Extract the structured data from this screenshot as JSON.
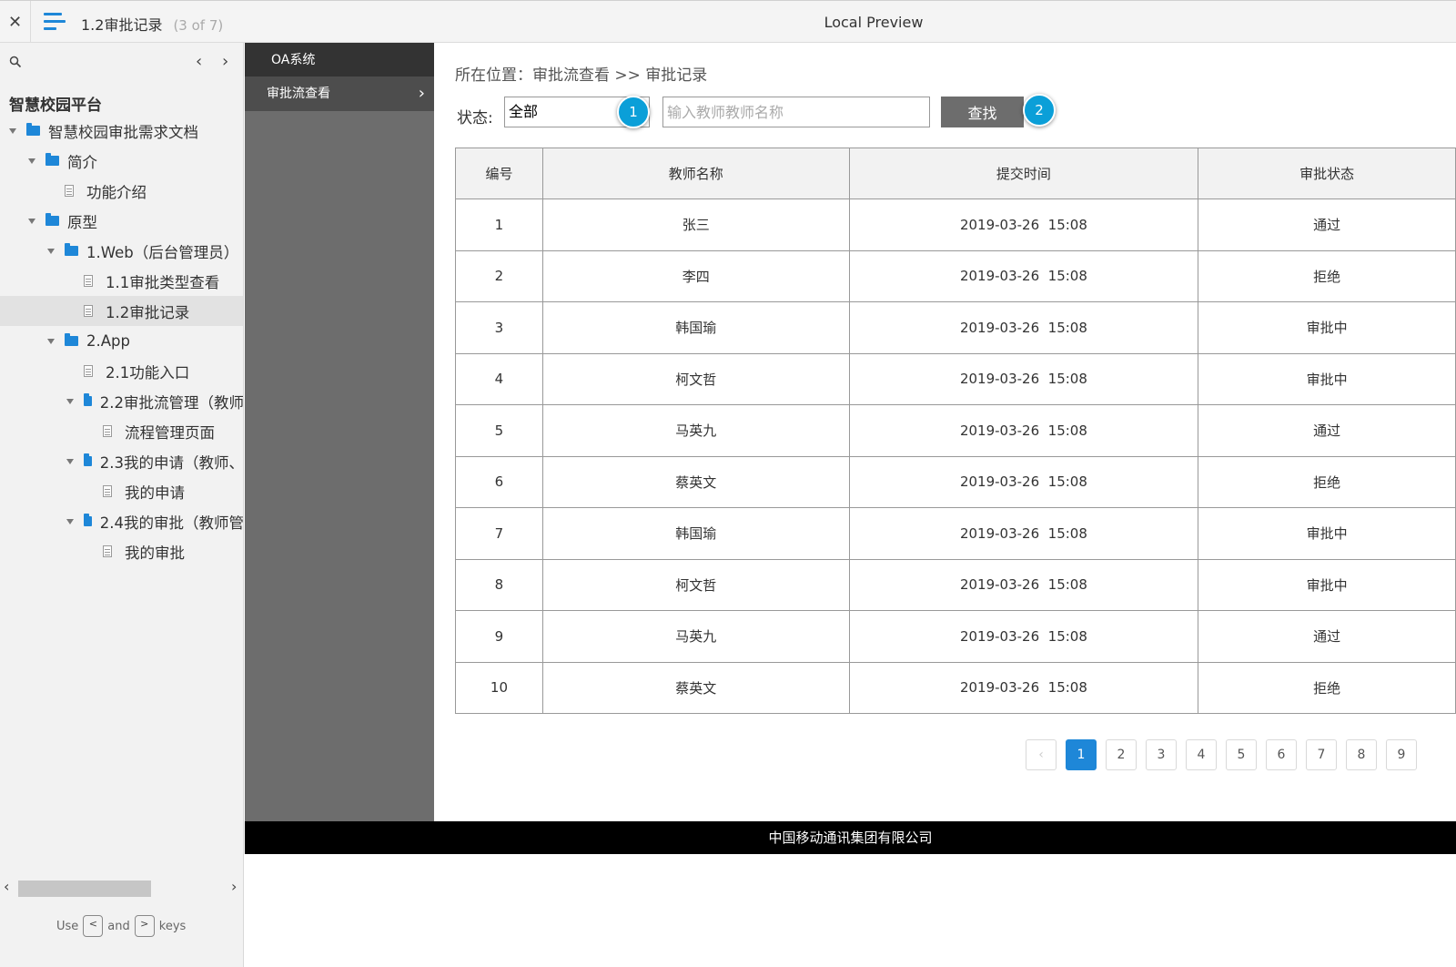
{
  "topbar": {
    "close_label": "✕",
    "page_title": "1.2审批记录",
    "page_count": "(3 of 7)",
    "window_title": "Local Preview"
  },
  "sidebar": {
    "root_title": "智慧校园平台",
    "tree": [
      {
        "label": "智慧校园审批需求文档",
        "kind": "folder",
        "level": 0
      },
      {
        "label": "简介",
        "kind": "folder",
        "level": 1
      },
      {
        "label": "功能介绍",
        "kind": "page",
        "level": 2
      },
      {
        "label": "原型",
        "kind": "folder",
        "level": 1
      },
      {
        "label": "1.Web（后台管理员）",
        "kind": "folder",
        "level": 2
      },
      {
        "label": "1.1审批类型查看",
        "kind": "page",
        "level": 3
      },
      {
        "label": "1.2审批记录",
        "kind": "page",
        "level": 3,
        "selected": true
      },
      {
        "label": "2.App",
        "kind": "folder",
        "level": 2
      },
      {
        "label": "2.1功能入口",
        "kind": "page",
        "level": 3
      },
      {
        "label": "2.2审批流管理（教师",
        "kind": "folder",
        "level": 3
      },
      {
        "label": "流程管理页面",
        "kind": "page",
        "level": 4
      },
      {
        "label": "2.3我的申请（教师、",
        "kind": "folder",
        "level": 3
      },
      {
        "label": "我的申请",
        "kind": "page",
        "level": 4
      },
      {
        "label": "2.4我的审批（教师管",
        "kind": "folder",
        "level": 3
      },
      {
        "label": "我的审批",
        "kind": "page",
        "level": 4
      }
    ],
    "hint": {
      "use": "Use",
      "and": "and",
      "keys": "keys",
      "key_prev": "<",
      "key_next": ">"
    }
  },
  "app_menu": {
    "head": "OA系统",
    "item": "审批流查看"
  },
  "content": {
    "breadcrumb": "所在位置：审批流查看 >> 审批记录",
    "status_label": "状态:",
    "status_value": "全部",
    "name_placeholder": "输入教师教师名称",
    "search_label": "查找",
    "marker_1": "1",
    "marker_2": "2"
  },
  "table": {
    "headers": [
      "编号",
      "教师名称",
      "提交时间",
      "审批状态"
    ],
    "rows": [
      [
        "1",
        "张三",
        "2019-03-26  15:08",
        "通过"
      ],
      [
        "2",
        "李四",
        "2019-03-26  15:08",
        "拒绝"
      ],
      [
        "3",
        "韩国瑜",
        "2019-03-26  15:08",
        "审批中"
      ],
      [
        "4",
        "柯文哲",
        "2019-03-26  15:08",
        "审批中"
      ],
      [
        "5",
        "马英九",
        "2019-03-26  15:08",
        "通过"
      ],
      [
        "6",
        "蔡英文",
        "2019-03-26  15:08",
        "拒绝"
      ],
      [
        "7",
        "韩国瑜",
        "2019-03-26  15:08",
        "审批中"
      ],
      [
        "8",
        "柯文哲",
        "2019-03-26  15:08",
        "审批中"
      ],
      [
        "9",
        "马英九",
        "2019-03-26  15:08",
        "通过"
      ],
      [
        "10",
        "蔡英文",
        "2019-03-26  15:08",
        "拒绝"
      ]
    ]
  },
  "pager": {
    "prev": "‹",
    "pages": [
      "1",
      "2",
      "3",
      "4",
      "5",
      "6",
      "7",
      "8",
      "9"
    ],
    "current": "1"
  },
  "footer": "中国移动通讯集团有限公司",
  "colors": {
    "accent": "#1e87d8",
    "marker": "#0b9fd8",
    "menu_bg": "#6d6d6d",
    "menu_head": "#333333",
    "footer_bg": "#000000"
  }
}
